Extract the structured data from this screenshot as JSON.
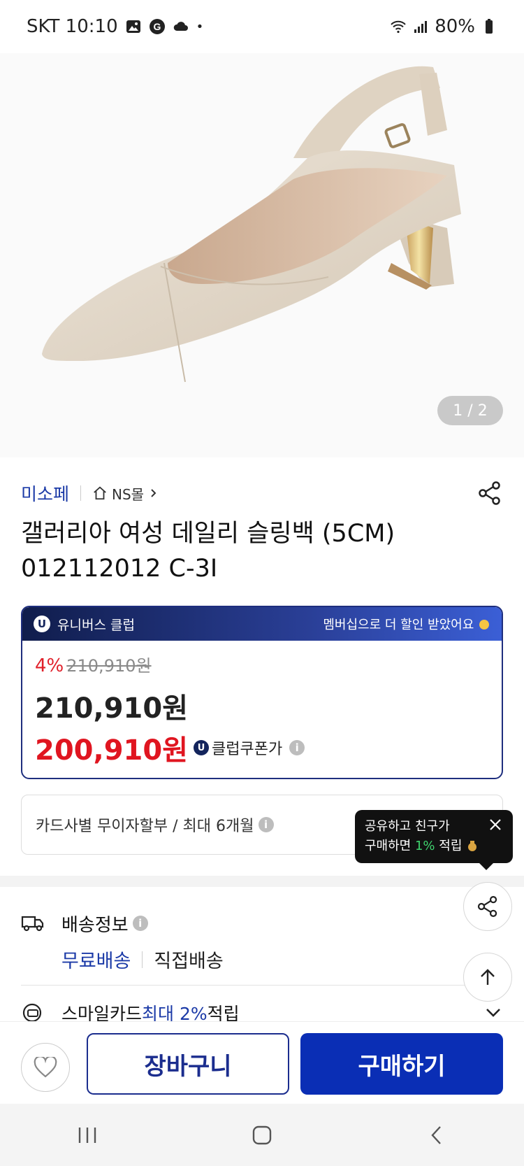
{
  "status_bar": {
    "carrier_time": "SKT 10:10",
    "battery": "80%"
  },
  "hero": {
    "page_indicator": "1 / 2"
  },
  "store": {
    "brand": "미소페",
    "mall": "NS몰"
  },
  "product": {
    "title": "갤러리아 여성 데일리 슬링백 (5CM) 012112012 C-3I"
  },
  "club": {
    "u_mark": "U",
    "name": "유니버스 클럽",
    "promo": "멤버십으로 더 할인 받았어요",
    "discount_rate": "4%",
    "original_price": "210,910원",
    "price": "210,910원",
    "coupon_price": "200,910원",
    "coupon_label": "클럽쿠폰가"
  },
  "installment": {
    "text": "카드사별 무이자할부 / 최대 6개월"
  },
  "tooltip": {
    "line1": "공유하고 친구가",
    "line2_prefix": "구매하면 ",
    "line2_rate": "1%",
    "line2_suffix": " 적립"
  },
  "delivery": {
    "title": "배송정보",
    "option_free": "무료배송",
    "option_direct": "직접배송"
  },
  "smile": {
    "prefix": "스마일카드 ",
    "highlight": "최대 2%",
    "suffix": " 적립"
  },
  "bottom": {
    "cart_label": "장바구니",
    "buy_label": "구매하기"
  },
  "colors": {
    "accent_blue": "#1b3aa7",
    "buy_blue": "#0a2eb5",
    "price_red": "#e01520"
  }
}
